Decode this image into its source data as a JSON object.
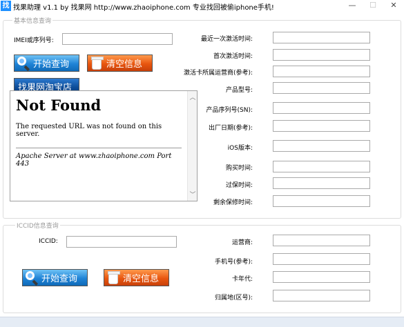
{
  "window": {
    "app_icon_char": "找",
    "title": "找果助理  v1.1      by 找果网  http://www.zhaoiphone.com  专业找回被偷iphone手机!",
    "minimize_label": "—",
    "maximize_label": "☐",
    "close_label": "✕"
  },
  "basic": {
    "caption": "基本信息查询",
    "imei_label": "IMEI或序列号:",
    "imei_value": "",
    "query_button": "开始查询",
    "clear_button": "清空信息",
    "shop_button": "找果网淘宝店",
    "fields": [
      {
        "label": "最近一次激活时间:",
        "value": ""
      },
      {
        "label": "首次激活时间:",
        "value": ""
      },
      {
        "label": "激活卡所属运营商(参考):",
        "value": ""
      },
      {
        "label": "产品型号:",
        "value": ""
      },
      {
        "label": "产品序列号(SN):",
        "value": ""
      },
      {
        "label": "出厂日期(参考):",
        "value": ""
      },
      {
        "label": "iOS版本:",
        "value": ""
      },
      {
        "label": "购买时间:",
        "value": ""
      },
      {
        "label": "过保时间:",
        "value": ""
      },
      {
        "label": "剩余保修时间:",
        "value": ""
      }
    ]
  },
  "browser": {
    "heading": "Not Found",
    "message": "The requested URL was not found on this server.",
    "address": "Apache Server at www.zhaoiphone.com Port 443",
    "scroll_up": "︿",
    "scroll_down": "﹀"
  },
  "iccid": {
    "caption": "ICCID信息查询",
    "iccid_label": "ICCID:",
    "iccid_value": "",
    "query_button": "开始查询",
    "clear_button": "清空信息",
    "fields": [
      {
        "label": "运营商:",
        "value": ""
      },
      {
        "label": "手机号(参考):",
        "value": ""
      },
      {
        "label": "卡年代:",
        "value": ""
      },
      {
        "label": "归属地(区号):",
        "value": ""
      }
    ]
  }
}
